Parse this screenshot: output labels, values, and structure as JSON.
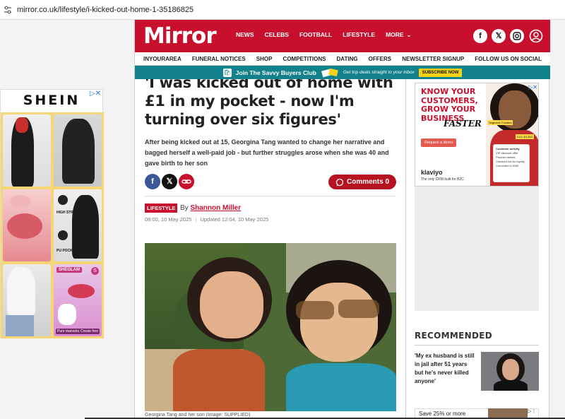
{
  "browser": {
    "url": "mirror.co.uk/lifestyle/i-kicked-out-home-1-35186825"
  },
  "left_ad": {
    "brand": "SHEIN",
    "tile_labels": [
      "HIGH STRETCH",
      "PU POCKETS"
    ],
    "sheglam": "SHEGLAM",
    "badge": "S",
    "cta_left": "Pure marvelous",
    "cta_right": "Create free"
  },
  "site": {
    "logo": "Mirror",
    "nav": [
      "NEWS",
      "CELEBS",
      "FOOTBALL",
      "LIFESTYLE",
      "MORE"
    ],
    "social": [
      "f",
      "X",
      "IG"
    ],
    "subnav": [
      "INYOURAREA",
      "FUNERAL NOTICES",
      "SHOP",
      "COMPETITIONS",
      "DATING",
      "OFFERS",
      "NEWSLETTER SIGNUP",
      "FOLLOW US ON SOCIAL"
    ],
    "banner": {
      "title": "Join The Savvy Buyers Club",
      "sub": "Get top deals straight to your inbox",
      "button": "SUBSCRIBE NOW"
    }
  },
  "article": {
    "headline": "'I was kicked out of home with £1 in my pocket - now I'm turning over six figures'",
    "standfirst": "After being kicked out at 15, Georgina Tang wanted to change her narrative and bagged herself a well-paid job - but further struggles arose when she was 40 and gave birth to her son",
    "comments": "Comments 0",
    "section": "LIFESTYLE",
    "by": "By",
    "author": "Shannon Miller",
    "published": "08:00, 10 May 2025",
    "updated": "Updated 12:04, 10 May 2025",
    "caption": "Georgina Tang and her son (Image: SUPPLIED)"
  },
  "sidebar": {
    "ad": {
      "headline": "KNOW YOUR CUSTOMERS, GROW YOUR BUSINESS",
      "faster": "FASTER",
      "button": "Request a demo",
      "brand": "klaviyo",
      "tagline": "The only CRM built for B2C",
      "panel_title": "Customer activity",
      "panel_items": [
        "VIP discount offer",
        "Product viewed",
        "Checked out for loyalty",
        "Converted in SMS"
      ],
      "chip_left": "Segment: Foodies",
      "chip_right": "CLV: £2,310"
    },
    "recommended_title": "RECOMMENDED",
    "recommended_item": "'My ex husband is still in jail after 51 years but he's never killed anyone'",
    "promo": "Save 25% or more"
  },
  "colors": {
    "brand": "#c8102e",
    "banner": "#12818b",
    "cta": "#f7d115"
  }
}
